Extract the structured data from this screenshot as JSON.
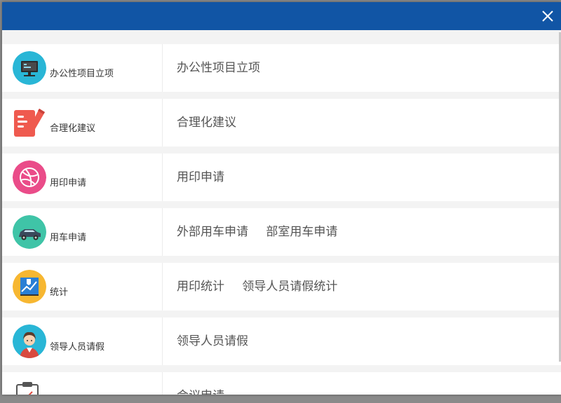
{
  "modal": {
    "close_icon": "close-icon",
    "header_color": "#1155a5"
  },
  "rows": [
    {
      "label": "办公性项目立项",
      "icon": "computer-monitor-icon",
      "links": [
        "办公性项目立项"
      ]
    },
    {
      "label": "合理化建议",
      "icon": "document-pen-icon",
      "links": [
        "合理化建议"
      ]
    },
    {
      "label": "用印申请",
      "icon": "seal-ball-icon",
      "links": [
        "用印申请"
      ]
    },
    {
      "label": "用车申请",
      "icon": "car-icon",
      "links": [
        "外部用车申请",
        "部室用车申请"
      ]
    },
    {
      "label": "统计",
      "icon": "chart-statistics-icon",
      "links": [
        "用印统计",
        "领导人员请假统计"
      ]
    },
    {
      "label": "领导人员请假",
      "icon": "person-avatar-icon",
      "links": [
        "领导人员请假"
      ]
    },
    {
      "label": "",
      "icon": "clipboard-icon",
      "links": [
        "会议申请"
      ]
    }
  ]
}
